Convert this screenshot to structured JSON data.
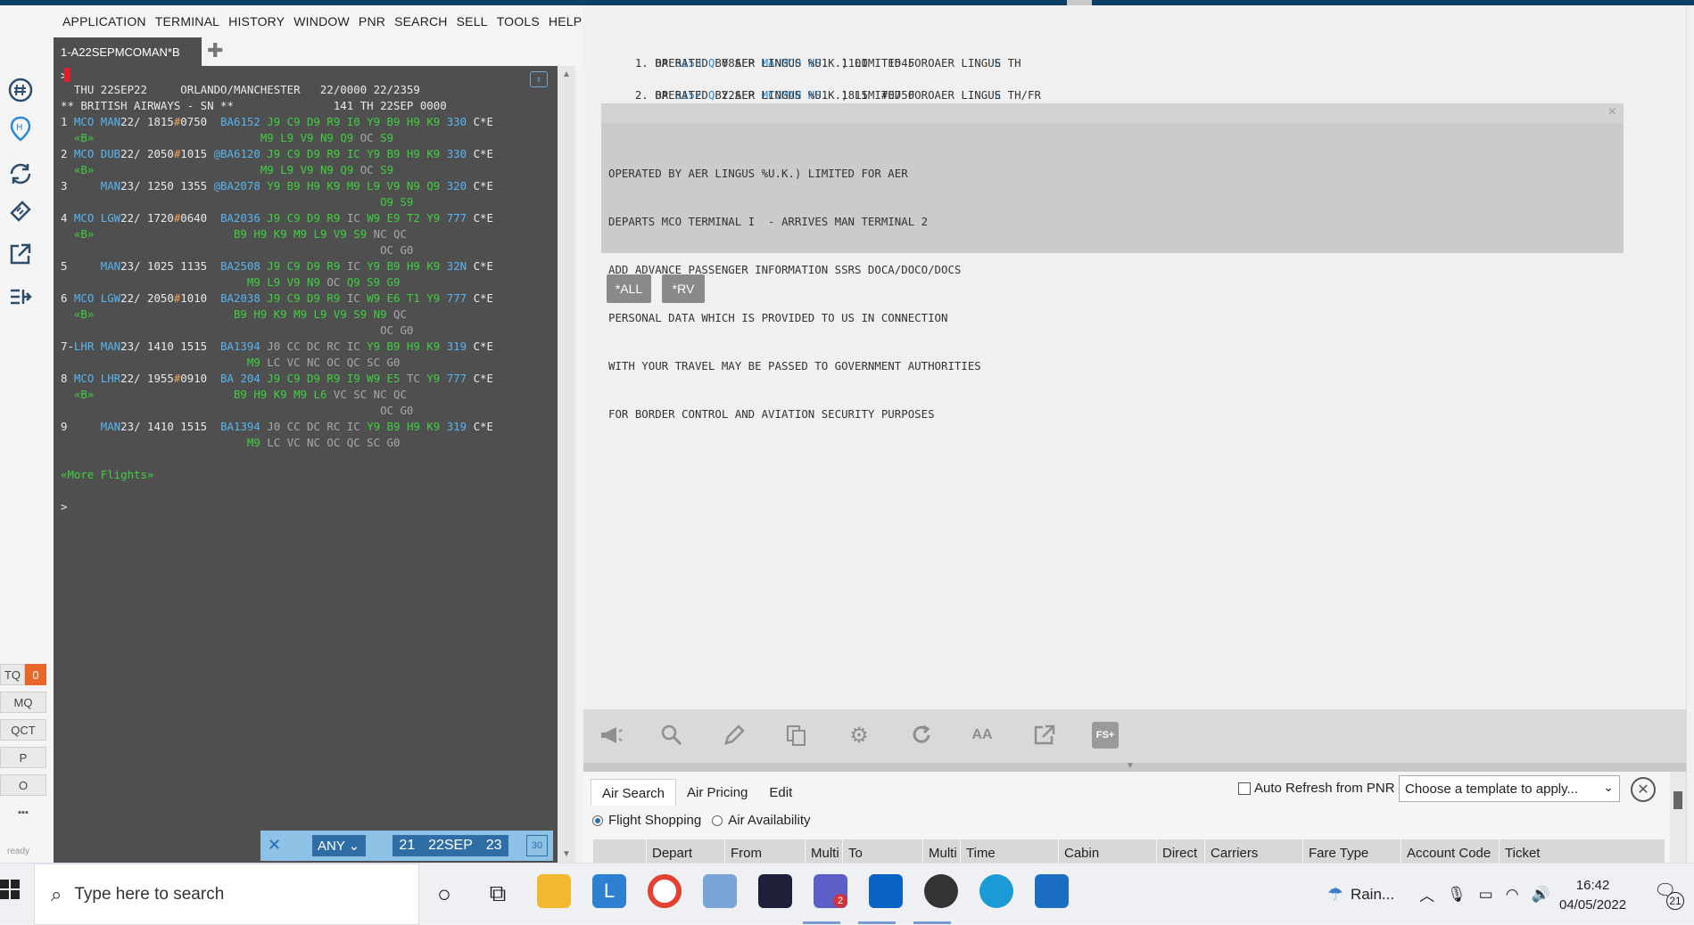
{
  "menu": [
    "APPLICATION",
    "TERMINAL",
    "HISTORY",
    "WINDOW",
    "PNR",
    "SEARCH",
    "SELL",
    "TOOLS",
    "HELP"
  ],
  "terminal": {
    "tab_label": "1-A22SEPMCOMAN*B",
    "prompt": ">",
    "lines": [
      [
        {
          "t": "  THU 22SEP22     ORLANDO/MANCHESTER   22/0000 22/2359",
          "c": ""
        }
      ],
      [
        {
          "t": "** BRITISH AIRWAYS - SN **               141 TH 22SEP 0000",
          "c": ""
        }
      ],
      [
        {
          "t": "1 ",
          "c": ""
        },
        {
          "t": "MCO MAN",
          "c": "blue"
        },
        {
          "t": "22/ 1815",
          "c": ""
        },
        {
          "t": "#",
          "c": "orange"
        },
        {
          "t": "0750  ",
          "c": ""
        },
        {
          "t": "BA6152 ",
          "c": "blue"
        },
        {
          "t": "J9 C9 D9 R9 I0 Y9 B9 H9 K9 ",
          "c": "green"
        },
        {
          "t": "330 ",
          "c": "blue"
        },
        {
          "t": "C*E",
          "c": ""
        }
      ],
      [
        {
          "t": "  ",
          "c": ""
        },
        {
          "t": "«B»",
          "c": "green"
        },
        {
          "t": "                         ",
          "c": ""
        },
        {
          "t": "M9 L9 V9 N9 Q9 ",
          "c": "green"
        },
        {
          "t": "OC ",
          "c": "grey"
        },
        {
          "t": "S9",
          "c": "green"
        }
      ],
      [
        {
          "t": "2 ",
          "c": ""
        },
        {
          "t": "MCO DUB",
          "c": "blue"
        },
        {
          "t": "22/ 2050",
          "c": ""
        },
        {
          "t": "#",
          "c": "orange"
        },
        {
          "t": "1015 ",
          "c": ""
        },
        {
          "t": "@BA6120 ",
          "c": "blue"
        },
        {
          "t": "J9 C9 D9 R9 IC Y9 B9 H9 K9 ",
          "c": "green"
        },
        {
          "t": "330 ",
          "c": "blue"
        },
        {
          "t": "C*E",
          "c": ""
        }
      ],
      [
        {
          "t": "  ",
          "c": ""
        },
        {
          "t": "«B»",
          "c": "green"
        },
        {
          "t": "                         ",
          "c": ""
        },
        {
          "t": "M9 L9 V9 N9 Q9 ",
          "c": "green"
        },
        {
          "t": "OC ",
          "c": "grey"
        },
        {
          "t": "S9",
          "c": "green"
        }
      ],
      [
        {
          "t": "3     ",
          "c": ""
        },
        {
          "t": "MAN",
          "c": "blue"
        },
        {
          "t": "23/ 1250 1355 ",
          "c": ""
        },
        {
          "t": "@BA2078 ",
          "c": "blue"
        },
        {
          "t": "Y9 B9 H9 K9 M9 L9 V9 N9 Q9 ",
          "c": "green"
        },
        {
          "t": "320 ",
          "c": "blue"
        },
        {
          "t": "C*E",
          "c": ""
        }
      ],
      [
        {
          "t": "                                                ",
          "c": ""
        },
        {
          "t": "O9 S9",
          "c": "green"
        }
      ],
      [
        {
          "t": "4 ",
          "c": ""
        },
        {
          "t": "MCO LGW",
          "c": "blue"
        },
        {
          "t": "22/ 1720",
          "c": ""
        },
        {
          "t": "#",
          "c": "orange"
        },
        {
          "t": "0640  ",
          "c": ""
        },
        {
          "t": "BA2036 ",
          "c": "blue"
        },
        {
          "t": "J9 C9 D9 R9 ",
          "c": "green"
        },
        {
          "t": "IC ",
          "c": "grey"
        },
        {
          "t": "W9 E9 T2 Y9 ",
          "c": "green"
        },
        {
          "t": "777 ",
          "c": "blue"
        },
        {
          "t": "C*E",
          "c": ""
        }
      ],
      [
        {
          "t": "  ",
          "c": ""
        },
        {
          "t": "«B»",
          "c": "green"
        },
        {
          "t": "                     ",
          "c": ""
        },
        {
          "t": "B9 H9 K9 M9 L9 V9 S9 ",
          "c": "green"
        },
        {
          "t": "NC QC",
          "c": "grey"
        }
      ],
      [
        {
          "t": "                                                ",
          "c": ""
        },
        {
          "t": "OC G0",
          "c": "grey"
        }
      ],
      [
        {
          "t": "5     ",
          "c": ""
        },
        {
          "t": "MAN",
          "c": "blue"
        },
        {
          "t": "23/ 1025 1135  ",
          "c": ""
        },
        {
          "t": "BA2508 ",
          "c": "blue"
        },
        {
          "t": "J9 C9 D9 R9 ",
          "c": "green"
        },
        {
          "t": "IC ",
          "c": "grey"
        },
        {
          "t": "Y9 B9 H9 K9 ",
          "c": "green"
        },
        {
          "t": "32N ",
          "c": "blue"
        },
        {
          "t": "C*E",
          "c": ""
        }
      ],
      [
        {
          "t": "                            ",
          "c": ""
        },
        {
          "t": "M9 L9 V9 N9 ",
          "c": "green"
        },
        {
          "t": "OC ",
          "c": "grey"
        },
        {
          "t": "Q9 S9 G9",
          "c": "green"
        }
      ],
      [
        {
          "t": "6 ",
          "c": ""
        },
        {
          "t": "MCO LGW",
          "c": "blue"
        },
        {
          "t": "22/ 2050",
          "c": ""
        },
        {
          "t": "#",
          "c": "orange"
        },
        {
          "t": "1010  ",
          "c": ""
        },
        {
          "t": "BA2038 ",
          "c": "blue"
        },
        {
          "t": "J9 C9 D9 R9 ",
          "c": "green"
        },
        {
          "t": "IC ",
          "c": "grey"
        },
        {
          "t": "W9 E6 T1 Y9 ",
          "c": "green"
        },
        {
          "t": "777 ",
          "c": "blue"
        },
        {
          "t": "C*E",
          "c": ""
        }
      ],
      [
        {
          "t": "  ",
          "c": ""
        },
        {
          "t": "«B»",
          "c": "green"
        },
        {
          "t": "                     ",
          "c": ""
        },
        {
          "t": "B9 H9 K9 M9 L9 V9 S9 N9 ",
          "c": "green"
        },
        {
          "t": "QC",
          "c": "grey"
        }
      ],
      [
        {
          "t": "                                                ",
          "c": ""
        },
        {
          "t": "OC G0",
          "c": "grey"
        }
      ],
      [
        {
          "t": "7-",
          "c": ""
        },
        {
          "t": "LHR MAN",
          "c": "blue"
        },
        {
          "t": "23/ 1410 1515  ",
          "c": ""
        },
        {
          "t": "BA1394 ",
          "c": "blue"
        },
        {
          "t": "J0 CC DC RC IC ",
          "c": "grey"
        },
        {
          "t": "Y9 B9 H9 K9 ",
          "c": "green"
        },
        {
          "t": "319 ",
          "c": "blue"
        },
        {
          "t": "C*E",
          "c": ""
        }
      ],
      [
        {
          "t": "                            ",
          "c": ""
        },
        {
          "t": "M9 ",
          "c": "green"
        },
        {
          "t": "LC VC NC OC QC SC G0",
          "c": "grey"
        }
      ],
      [
        {
          "t": "8 ",
          "c": ""
        },
        {
          "t": "MCO LHR",
          "c": "blue"
        },
        {
          "t": "22/ 1955",
          "c": ""
        },
        {
          "t": "#",
          "c": "orange"
        },
        {
          "t": "0910  ",
          "c": ""
        },
        {
          "t": "BA 204 ",
          "c": "blue"
        },
        {
          "t": "J9 C9 D9 R9 I9 W9 E5 ",
          "c": "green"
        },
        {
          "t": "TC ",
          "c": "grey"
        },
        {
          "t": "Y9 ",
          "c": "green"
        },
        {
          "t": "777 ",
          "c": "blue"
        },
        {
          "t": "C*E",
          "c": ""
        }
      ],
      [
        {
          "t": "  ",
          "c": ""
        },
        {
          "t": "«B»",
          "c": "green"
        },
        {
          "t": "                     ",
          "c": ""
        },
        {
          "t": "B9 H9 K9 M9 L6 ",
          "c": "green"
        },
        {
          "t": "VC SC NC QC",
          "c": "grey"
        }
      ],
      [
        {
          "t": "                                                ",
          "c": ""
        },
        {
          "t": "OC G0",
          "c": "grey"
        }
      ],
      [
        {
          "t": "9     ",
          "c": ""
        },
        {
          "t": "MAN",
          "c": "blue"
        },
        {
          "t": "23/ 1410 1515  ",
          "c": ""
        },
        {
          "t": "BA1394 ",
          "c": "blue"
        },
        {
          "t": "J0 CC DC RC IC ",
          "c": "grey"
        },
        {
          "t": "Y9 B9 H9 K9 ",
          "c": "green"
        },
        {
          "t": "319 ",
          "c": "blue"
        },
        {
          "t": "C*E",
          "c": ""
        }
      ],
      [
        {
          "t": "                            ",
          "c": ""
        },
        {
          "t": "M9 ",
          "c": "green"
        },
        {
          "t": "LC VC NC OC QC SC G0",
          "c": "grey"
        }
      ]
    ],
    "more_flights": "«More Flights»",
    "bottom_prompt": ">",
    "nav": {
      "any": "ANY",
      "prev": "21",
      "date": "22SEP",
      "next": "23",
      "cal": "30"
    }
  },
  "rail": {
    "icons": [
      "hash-icon",
      "location-icon",
      "refresh-icon",
      "ticket-icon",
      "external-link-icon",
      "list-arrow-icon"
    ],
    "queues": [
      "TQ",
      "MQ",
      "QCT",
      "P",
      "O",
      "▪▪▪"
    ],
    "tq_count": "0",
    "status": "ready"
  },
  "response": {
    "lines": [
      "1. BA 6153 Q 08SEP MANMCO HS1  1100   1545  O         E TH",
      "       OPERATED BY AER LINGUS %U.K.) LIMITED FOR AER LINGUS",
      "2. BA 6152 Q 22SEP MCOMAN HS1  1815  #0750  O         E TH/FR",
      "       OPERATED BY AER LINGUS %U.K.) LIMITED FOR AER LINGUS"
    ],
    "info": [
      "OPERATED BY AER LINGUS %U.K.) LIMITED FOR AER",
      "DEPARTS MCO TERMINAL I  - ARRIVES MAN TERMINAL 2",
      "ADD ADVANCE PASSENGER INFORMATION SSRS DOCA/DOCO/DOCS",
      "PERSONAL DATA WHICH IS PROVIDED TO US IN CONNECTION",
      "WITH YOUR TRAVEL MAY BE PASSED TO GOVERNMENT AUTHORITIES",
      "FOR BORDER CONTROL AND AVIATION SECURITY PURPOSES"
    ],
    "close": "×",
    "buttons": [
      "*ALL",
      "*RV"
    ]
  },
  "toolbar": {
    "icons": [
      "megaphone-icon",
      "search-icon",
      "pencil-icon",
      "copy-icon",
      "gear-icon",
      "refresh-icon",
      "font-size-icon",
      "external-link-icon",
      "fs-icon"
    ],
    "fs_label": "FS+"
  },
  "bottom": {
    "tabs": [
      "Air Search",
      "Air Pricing",
      "Edit"
    ],
    "auto_refresh": "Auto Refresh from PNR",
    "template_placeholder": "Choose a template to apply...",
    "radios": [
      "Flight Shopping",
      "Air Availability"
    ],
    "columns": [
      "",
      "Depart",
      "From",
      "Multi",
      "To",
      "Multi",
      "Time",
      "Cabin",
      "Direct",
      "Carriers",
      "Fare Type",
      "Account Code",
      "Ticket"
    ]
  },
  "taskbar": {
    "search_placeholder": "Type here to search",
    "weather": "Rain...",
    "time": "16:42",
    "date": "04/05/2022",
    "notifications": "21",
    "teams_badge": "2"
  }
}
